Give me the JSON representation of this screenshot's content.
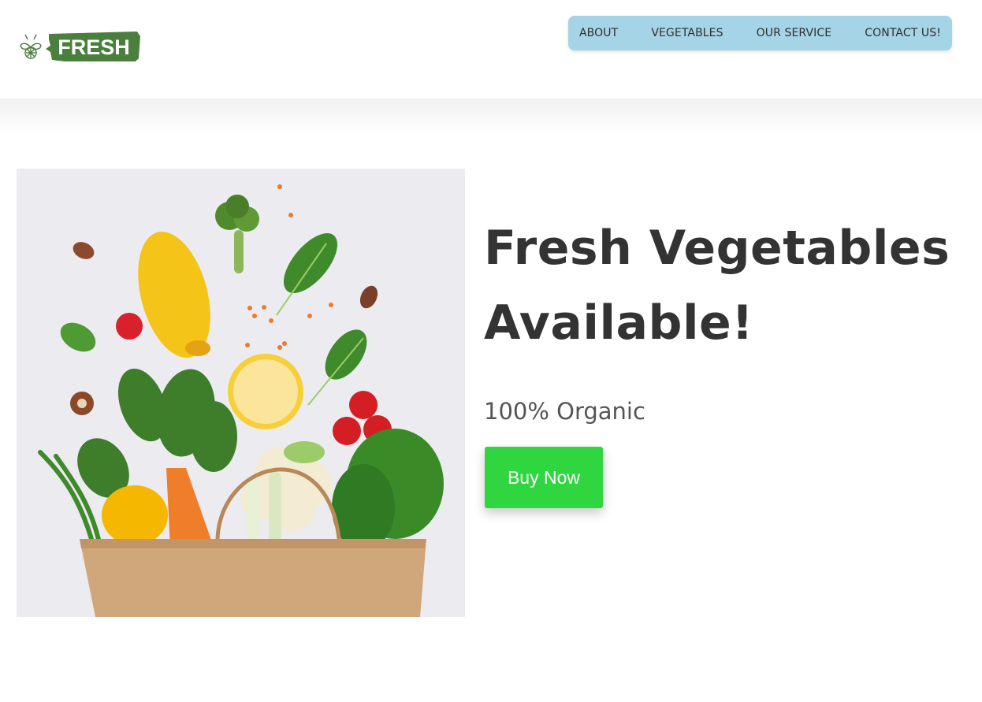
{
  "brand": {
    "name": "FRESH",
    "color": "#4a7f3e",
    "icon": "plant-sprout-icon"
  },
  "nav": {
    "background": "#a4d4e6",
    "items": [
      {
        "label": "ABOUT"
      },
      {
        "label": "VEGETABLES"
      },
      {
        "label": "OUR SERVICE"
      },
      {
        "label": "CONTACT US!"
      }
    ]
  },
  "hero": {
    "title_line1": "Fresh Vegetables",
    "title_line2": "Available!",
    "subtitle": "100% Organic",
    "cta_label": "Buy Now",
    "cta_color": "#2fd63f",
    "image_icon": "grocery-bag-vegetables-image"
  }
}
